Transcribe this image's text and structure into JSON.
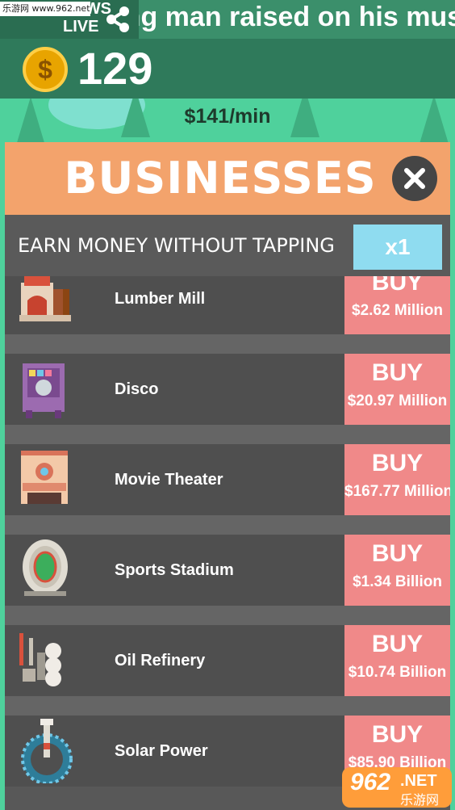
{
  "watermark_top": "乐游网 www.962.net",
  "news": {
    "live_line1": "NEWS",
    "live_line2": "LIVE",
    "ticker": "Young man raised on his music"
  },
  "currency": {
    "coins": "129",
    "rate": "$141/min"
  },
  "panel": {
    "title": "BUSINESSES",
    "subtitle": "EARN MONEY WITHOUT TAPPING",
    "multiplier": "x1"
  },
  "businesses": [
    {
      "name": "Lumber Mill",
      "buy": "BUY",
      "price": "$2.62 Million",
      "icon": "lumber-mill-icon"
    },
    {
      "name": "Disco",
      "buy": "BUY",
      "price": "$20.97 Million",
      "icon": "disco-icon"
    },
    {
      "name": "Movie Theater",
      "buy": "BUY",
      "price": "$167.77 Million",
      "icon": "movie-theater-icon"
    },
    {
      "name": "Sports Stadium",
      "buy": "BUY",
      "price": "$1.34 Billion",
      "icon": "sports-stadium-icon"
    },
    {
      "name": "Oil Refinery",
      "buy": "BUY",
      "price": "$10.74 Billion",
      "icon": "oil-refinery-icon"
    },
    {
      "name": "Solar Power",
      "buy": "BUY",
      "price": "$85.90 Billion",
      "icon": "solar-power-icon"
    }
  ],
  "watermark_bottom": {
    "logo": "962",
    "net": ".NET",
    "cn": "乐游网"
  },
  "colors": {
    "panel_header": "#f3a36c",
    "buy_button": "#f08989",
    "multiplier_button": "#8fdcf0",
    "topbar": "#2f7a5b"
  }
}
